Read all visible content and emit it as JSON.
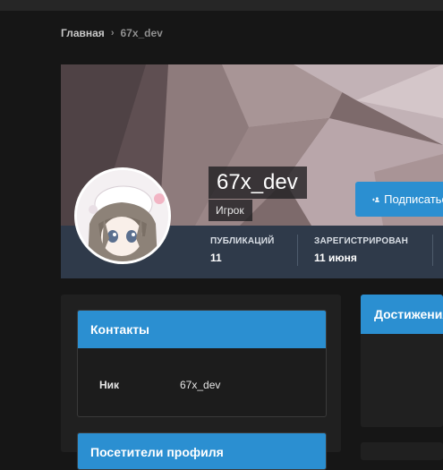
{
  "breadcrumb": {
    "home": "Главная",
    "separator": "›",
    "current": "67x_dev"
  },
  "profile": {
    "username": "67x_dev",
    "role": "Игрок",
    "subscribe_label": "Подписаться",
    "stats": [
      {
        "label": "ПУБЛИКАЦИЙ",
        "value": "11"
      },
      {
        "label": "ЗАРЕГИСТРИРОВАН",
        "value": "11 июня"
      }
    ]
  },
  "contacts_card": {
    "title": "Контакты",
    "rows": [
      {
        "label": "Ник",
        "value": "67x_dev"
      }
    ]
  },
  "visitors_card": {
    "title": "Посетители профиля"
  },
  "achievements_card": {
    "title": "Достижения"
  },
  "colors": {
    "accent": "#2b8fd1",
    "background": "#161616",
    "panel": "#202020",
    "stats_bar": "#2f3a4a"
  },
  "icons": {
    "subscribe": "user-plus-icon",
    "breadcrumb_separator": "chevron-right-icon"
  }
}
